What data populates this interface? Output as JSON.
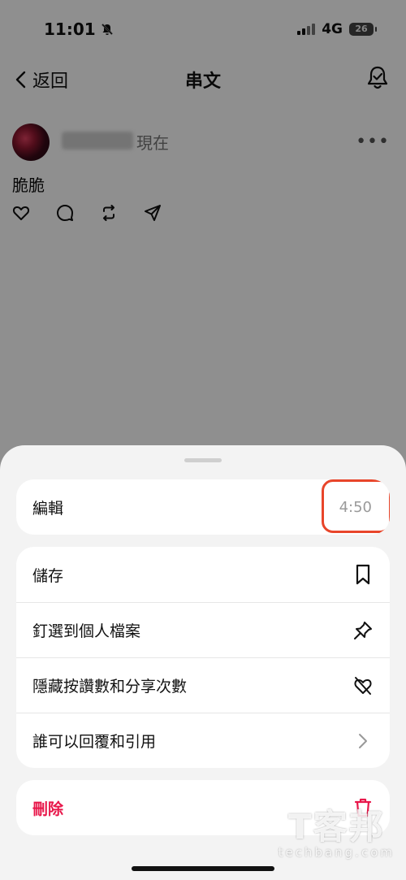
{
  "status_bar": {
    "time": "11:01",
    "network": "4G",
    "battery": "26"
  },
  "nav": {
    "back_label": "返回",
    "title": "串文"
  },
  "post": {
    "timestamp": "現在",
    "text": "脆脆"
  },
  "sheet": {
    "edit": {
      "label": "編輯",
      "timer": "4:50"
    },
    "options": [
      {
        "label": "儲存",
        "icon": "bookmark-icon"
      },
      {
        "label": "釘選到個人檔案",
        "icon": "pin-icon"
      },
      {
        "label": "隱藏按讚數和分享次數",
        "icon": "heart-off-icon"
      },
      {
        "label": "誰可以回覆和引用",
        "icon": "chevron-right-icon"
      }
    ],
    "delete": {
      "label": "刪除",
      "icon": "trash-icon"
    }
  },
  "colors": {
    "accent_danger": "#e8174a",
    "highlight_border": "#e8452a",
    "overlay": "#8e8e8e"
  },
  "watermark": {
    "text_main": "T客邦",
    "text_sub": "techbang.com"
  }
}
